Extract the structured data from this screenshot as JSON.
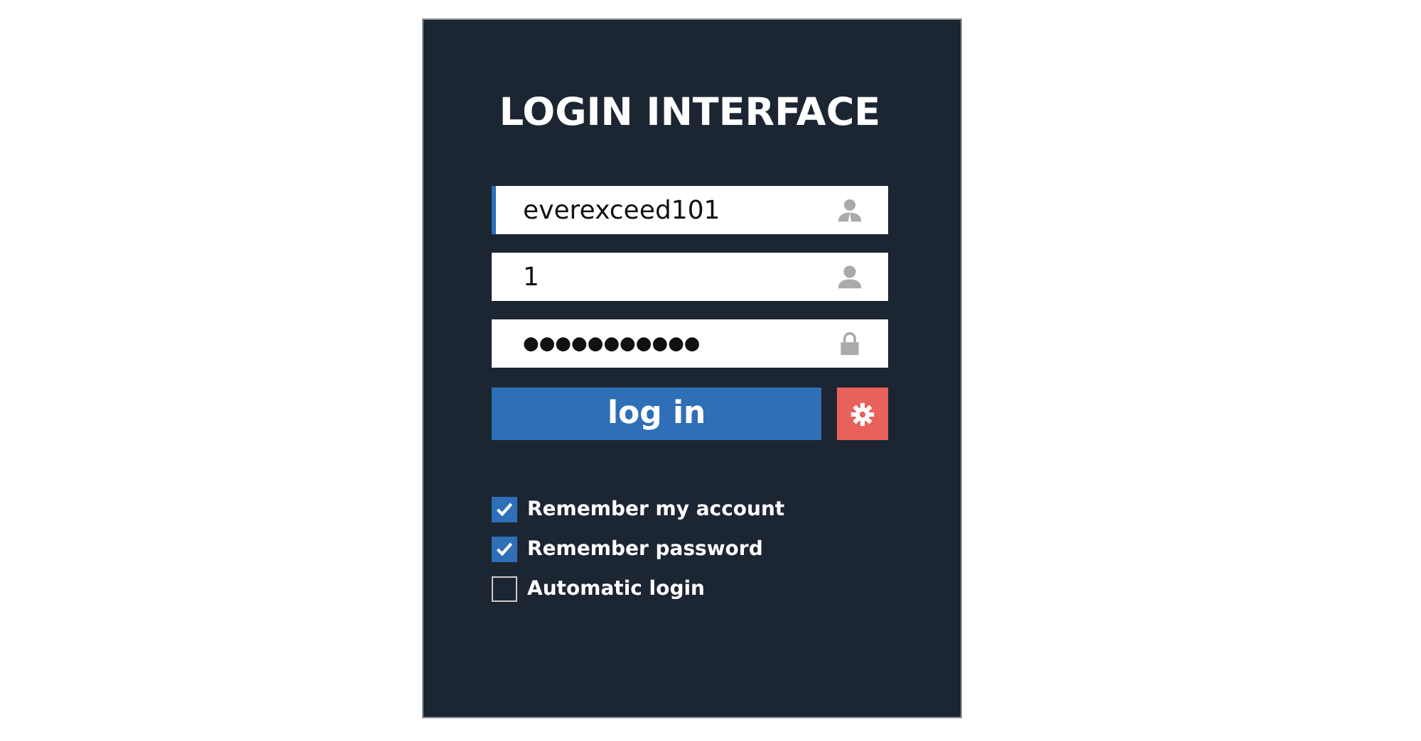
{
  "title": "LOGIN INTERFACE",
  "fields": [
    {
      "kind": "account",
      "value": "everexceed101",
      "focused": true
    },
    {
      "kind": "user",
      "value": "1",
      "focused": false
    },
    {
      "kind": "lock",
      "value": "●●●●●●●●●●●",
      "focused": false
    }
  ],
  "login_button": "log in",
  "options": [
    {
      "label": "Remember my account",
      "checked": true
    },
    {
      "label": "Remember password",
      "checked": true
    },
    {
      "label": "Automatic login",
      "checked": false
    }
  ]
}
